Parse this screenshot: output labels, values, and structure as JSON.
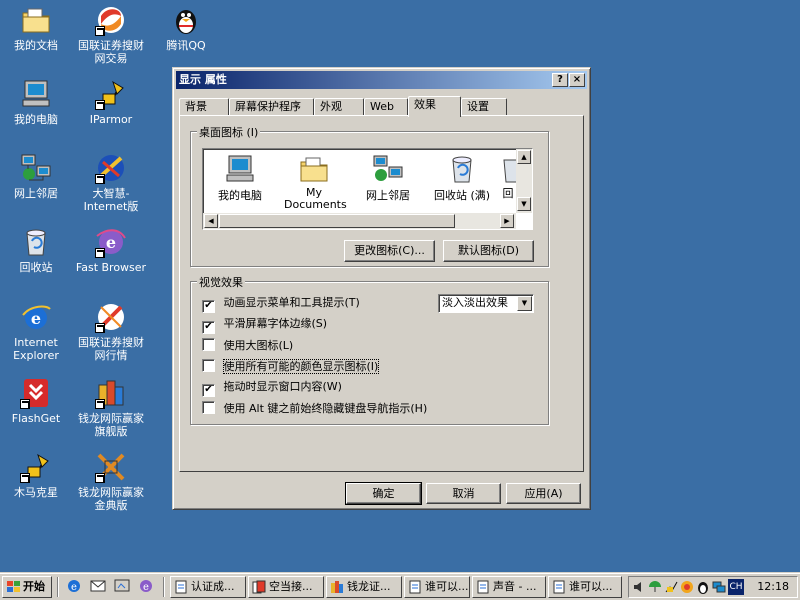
{
  "desktop": {
    "icons": [
      {
        "label": "我的文档"
      },
      {
        "label": "国联证券搜财网交易"
      },
      {
        "label": "腾讯QQ"
      },
      {
        "label": "我的电脑"
      },
      {
        "label": "IParmor"
      },
      {
        "label": "网上邻居"
      },
      {
        "label": "大智慧-Internet版"
      },
      {
        "label": "回收站"
      },
      {
        "label": "Fast Browser"
      },
      {
        "label": "Internet Explorer"
      },
      {
        "label": "国联证券搜财网行情"
      },
      {
        "label": "FlashGet"
      },
      {
        "label": "钱龙网际赢家旗舰版"
      },
      {
        "label": "木马克星"
      },
      {
        "label": "钱龙网际赢家金典版"
      }
    ]
  },
  "window": {
    "title": "显示 属性",
    "help_btn": "?",
    "close_btn": "×",
    "tabs": [
      {
        "label": "背景"
      },
      {
        "label": "屏幕保护程序"
      },
      {
        "label": "外观"
      },
      {
        "label": "Web"
      },
      {
        "label": "效果"
      },
      {
        "label": "设置"
      }
    ],
    "desktop_icons_group": {
      "label": "桌面图标 (I)",
      "items": [
        {
          "label": "我的电脑"
        },
        {
          "label": "My Documents"
        },
        {
          "label": "网上邻居"
        },
        {
          "label": "回收站 (满)"
        },
        {
          "label": "回"
        }
      ],
      "change_icon_btn": "更改图标(C)...",
      "default_icon_btn": "默认图标(D)"
    },
    "visual_effects_group": {
      "label": "视觉效果",
      "options": [
        {
          "label": "动画显示菜单和工具提示(T)",
          "checked": "✔"
        },
        {
          "label": "平滑屏幕字体边缘(S)",
          "checked": "✔"
        },
        {
          "label": "使用大图标(L)",
          "checked": ""
        },
        {
          "label": "使用所有可能的颜色显示图标(I)",
          "checked": ""
        },
        {
          "label": "拖动时显示窗口内容(W)",
          "checked": "✔"
        },
        {
          "label": "使用 Alt 键之前始终隐藏键盘导航指示(H)",
          "checked": ""
        }
      ],
      "effect_select_value": "淡入淡出效果"
    },
    "buttons": {
      "ok": "确定",
      "cancel": "取消",
      "apply": "应用(A)"
    }
  },
  "taskbar": {
    "start_label": "开始",
    "tasks": [
      {
        "label": "认证成..."
      },
      {
        "label": "空当接..."
      },
      {
        "label": "钱龙证..."
      },
      {
        "label": "谁可以..."
      },
      {
        "label": "声音 - ..."
      },
      {
        "label": "谁可以..."
      }
    ],
    "tray_lang": "CH",
    "clock": "12:18"
  },
  "colors": {
    "desktop": "#3a6ea5",
    "title_active": "#0a246a",
    "face": "#d4d0c8"
  }
}
